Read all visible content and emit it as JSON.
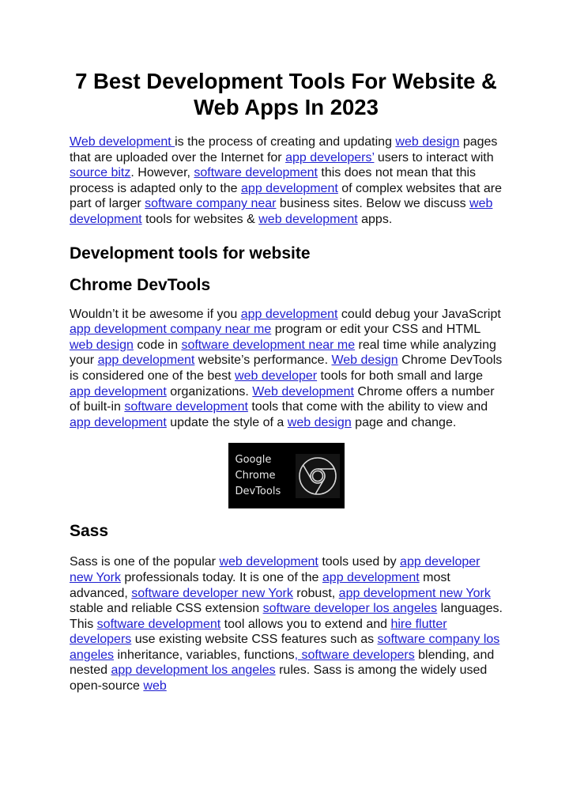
{
  "title": "7 Best Development Tools For Website & Web Apps In 2023",
  "intro": [
    {
      "t": "link",
      "v": "Web development "
    },
    {
      "t": "text",
      "v": "is the process of creating and updating "
    },
    {
      "t": "link",
      "v": "web design"
    },
    {
      "t": "text",
      "v": " pages that are uploaded over the Internet for "
    },
    {
      "t": "link",
      "v": "app developers’"
    },
    {
      "t": "text",
      "v": " users to interact with "
    },
    {
      "t": "link",
      "v": "source bitz"
    },
    {
      "t": "text",
      "v": ". However, "
    },
    {
      "t": "link",
      "v": "software development"
    },
    {
      "t": "text",
      "v": " this does not mean that this process is adapted only to the "
    },
    {
      "t": "link",
      "v": "app development"
    },
    {
      "t": "text",
      "v": " of complex websites that are part of larger "
    },
    {
      "t": "link",
      "v": "software company near"
    },
    {
      "t": "text",
      "v": " business sites. Below we discuss "
    },
    {
      "t": "link",
      "v": "web development"
    },
    {
      "t": "text",
      "v": " tools for websites & "
    },
    {
      "t": "link",
      "v": "web development"
    },
    {
      "t": "text",
      "v": " apps."
    }
  ],
  "section_heading": "Development tools for website",
  "chrome": {
    "heading": "Chrome DevTools",
    "paragraph": [
      {
        "t": "text",
        "v": "Wouldn’t it be awesome if you "
      },
      {
        "t": "link",
        "v": "app development"
      },
      {
        "t": "text",
        "v": " could debug your JavaScript "
      },
      {
        "t": "link",
        "v": "app development company near me"
      },
      {
        "t": "text",
        "v": " program or edit your CSS and HTML "
      },
      {
        "t": "link",
        "v": "web design"
      },
      {
        "t": "text",
        "v": " code in "
      },
      {
        "t": "link",
        "v": "software development near me"
      },
      {
        "t": "text",
        "v": " real time while analyzing your "
      },
      {
        "t": "link",
        "v": "app development"
      },
      {
        "t": "text",
        "v": " website’s performance. "
      },
      {
        "t": "link",
        "v": "Web design"
      },
      {
        "t": "text",
        "v": " Chrome DevTools is considered one of the best "
      },
      {
        "t": "link",
        "v": "web developer"
      },
      {
        "t": "text",
        "v": " tools for both small and large "
      },
      {
        "t": "link",
        "v": "app development"
      },
      {
        "t": "text",
        "v": " organizations. "
      },
      {
        "t": "link",
        "v": "Web development"
      },
      {
        "t": "text",
        "v": " Chrome offers a number of built-in "
      },
      {
        "t": "link",
        "v": "software development"
      },
      {
        "t": "text",
        "v": " tools that come with the ability to view and "
      },
      {
        "t": "link",
        "v": "app development"
      },
      {
        "t": "text",
        "v": " update the style of a "
      },
      {
        "t": "link",
        "v": "web design"
      },
      {
        "t": "text",
        "v": " page and change."
      }
    ],
    "image": {
      "lines": [
        "Google",
        "Chrome",
        "DevTools"
      ],
      "icon": "chrome-logo-icon"
    }
  },
  "sass": {
    "heading": "Sass",
    "paragraph": [
      {
        "t": "text",
        "v": "Sass is one of the popular "
      },
      {
        "t": "link",
        "v": "web development"
      },
      {
        "t": "text",
        "v": " tools used by "
      },
      {
        "t": "link",
        "v": "app developer new York"
      },
      {
        "t": "text",
        "v": " professionals today. It is one of the "
      },
      {
        "t": "link",
        "v": "app development"
      },
      {
        "t": "text",
        "v": " most advanced, "
      },
      {
        "t": "link",
        "v": "software developer new York"
      },
      {
        "t": "text",
        "v": " robust, "
      },
      {
        "t": "link",
        "v": "app development new York"
      },
      {
        "t": "text",
        "v": " stable and reliable CSS extension "
      },
      {
        "t": "link",
        "v": "software developer los angeles"
      },
      {
        "t": "text",
        "v": " languages. This "
      },
      {
        "t": "link",
        "v": "software development"
      },
      {
        "t": "text",
        "v": " tool allows you to extend and "
      },
      {
        "t": "link",
        "v": "hire flutter developers"
      },
      {
        "t": "text",
        "v": " use existing website CSS features such as "
      },
      {
        "t": "link",
        "v": "software company los angeles"
      },
      {
        "t": "text",
        "v": " inheritance, variables, functions"
      },
      {
        "t": "link",
        "v": ", software developers"
      },
      {
        "t": "text",
        "v": " blending, and nested "
      },
      {
        "t": "link",
        "v": "app development los angeles"
      },
      {
        "t": "text",
        "v": " rules. Sass is among the widely used open-source "
      },
      {
        "t": "link",
        "v": "web"
      }
    ]
  },
  "colors": {
    "link": "#1f1fd1",
    "text": "#111111",
    "image_bg": "#000000"
  }
}
